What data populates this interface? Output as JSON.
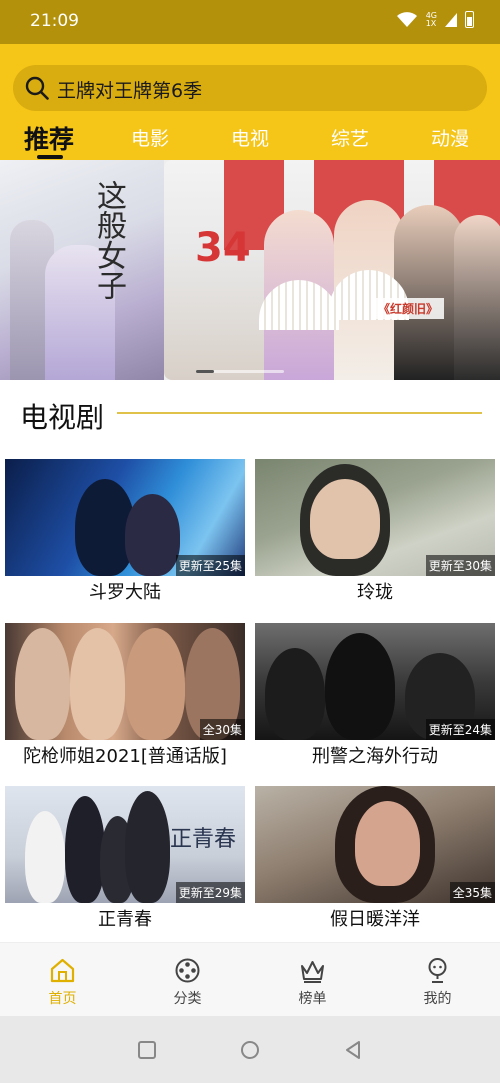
{
  "status_bar": {
    "time": "21:09",
    "network_top": "4G",
    "network_bottom": "1X"
  },
  "search": {
    "text": "王牌对王牌第6季",
    "icon": "search-icon"
  },
  "tabs": [
    {
      "label": "推荐",
      "active": true
    },
    {
      "label": "电影"
    },
    {
      "label": "电视"
    },
    {
      "label": "综艺"
    },
    {
      "label": "动漫"
    }
  ],
  "banner": {
    "left_calligraphy": "这般女子",
    "right_caption": "《红颜旧》",
    "right_logo": "34"
  },
  "section": {
    "title": "电视剧"
  },
  "items": [
    {
      "title": "斗罗大陆",
      "badge": "更新至25集"
    },
    {
      "title": "玲珑",
      "badge": "更新至30集"
    },
    {
      "title": "陀枪师姐2021[普通话版]",
      "badge": "全30集"
    },
    {
      "title": "刑警之海外行动",
      "badge": "更新至24集"
    },
    {
      "title": "正青春",
      "badge": "更新至29集"
    },
    {
      "title": "假日暖洋洋",
      "badge": "全35集"
    }
  ],
  "nav": [
    {
      "label": "首页",
      "icon": "home-icon",
      "active": true
    },
    {
      "label": "分类",
      "icon": "category-reel-icon"
    },
    {
      "label": "榜单",
      "icon": "ranking-crown-icon"
    },
    {
      "label": "我的",
      "icon": "profile-icon"
    }
  ],
  "colors": {
    "accent": "#f5c518",
    "status_bar": "#b3910a",
    "active_nav": "#e0b000"
  }
}
